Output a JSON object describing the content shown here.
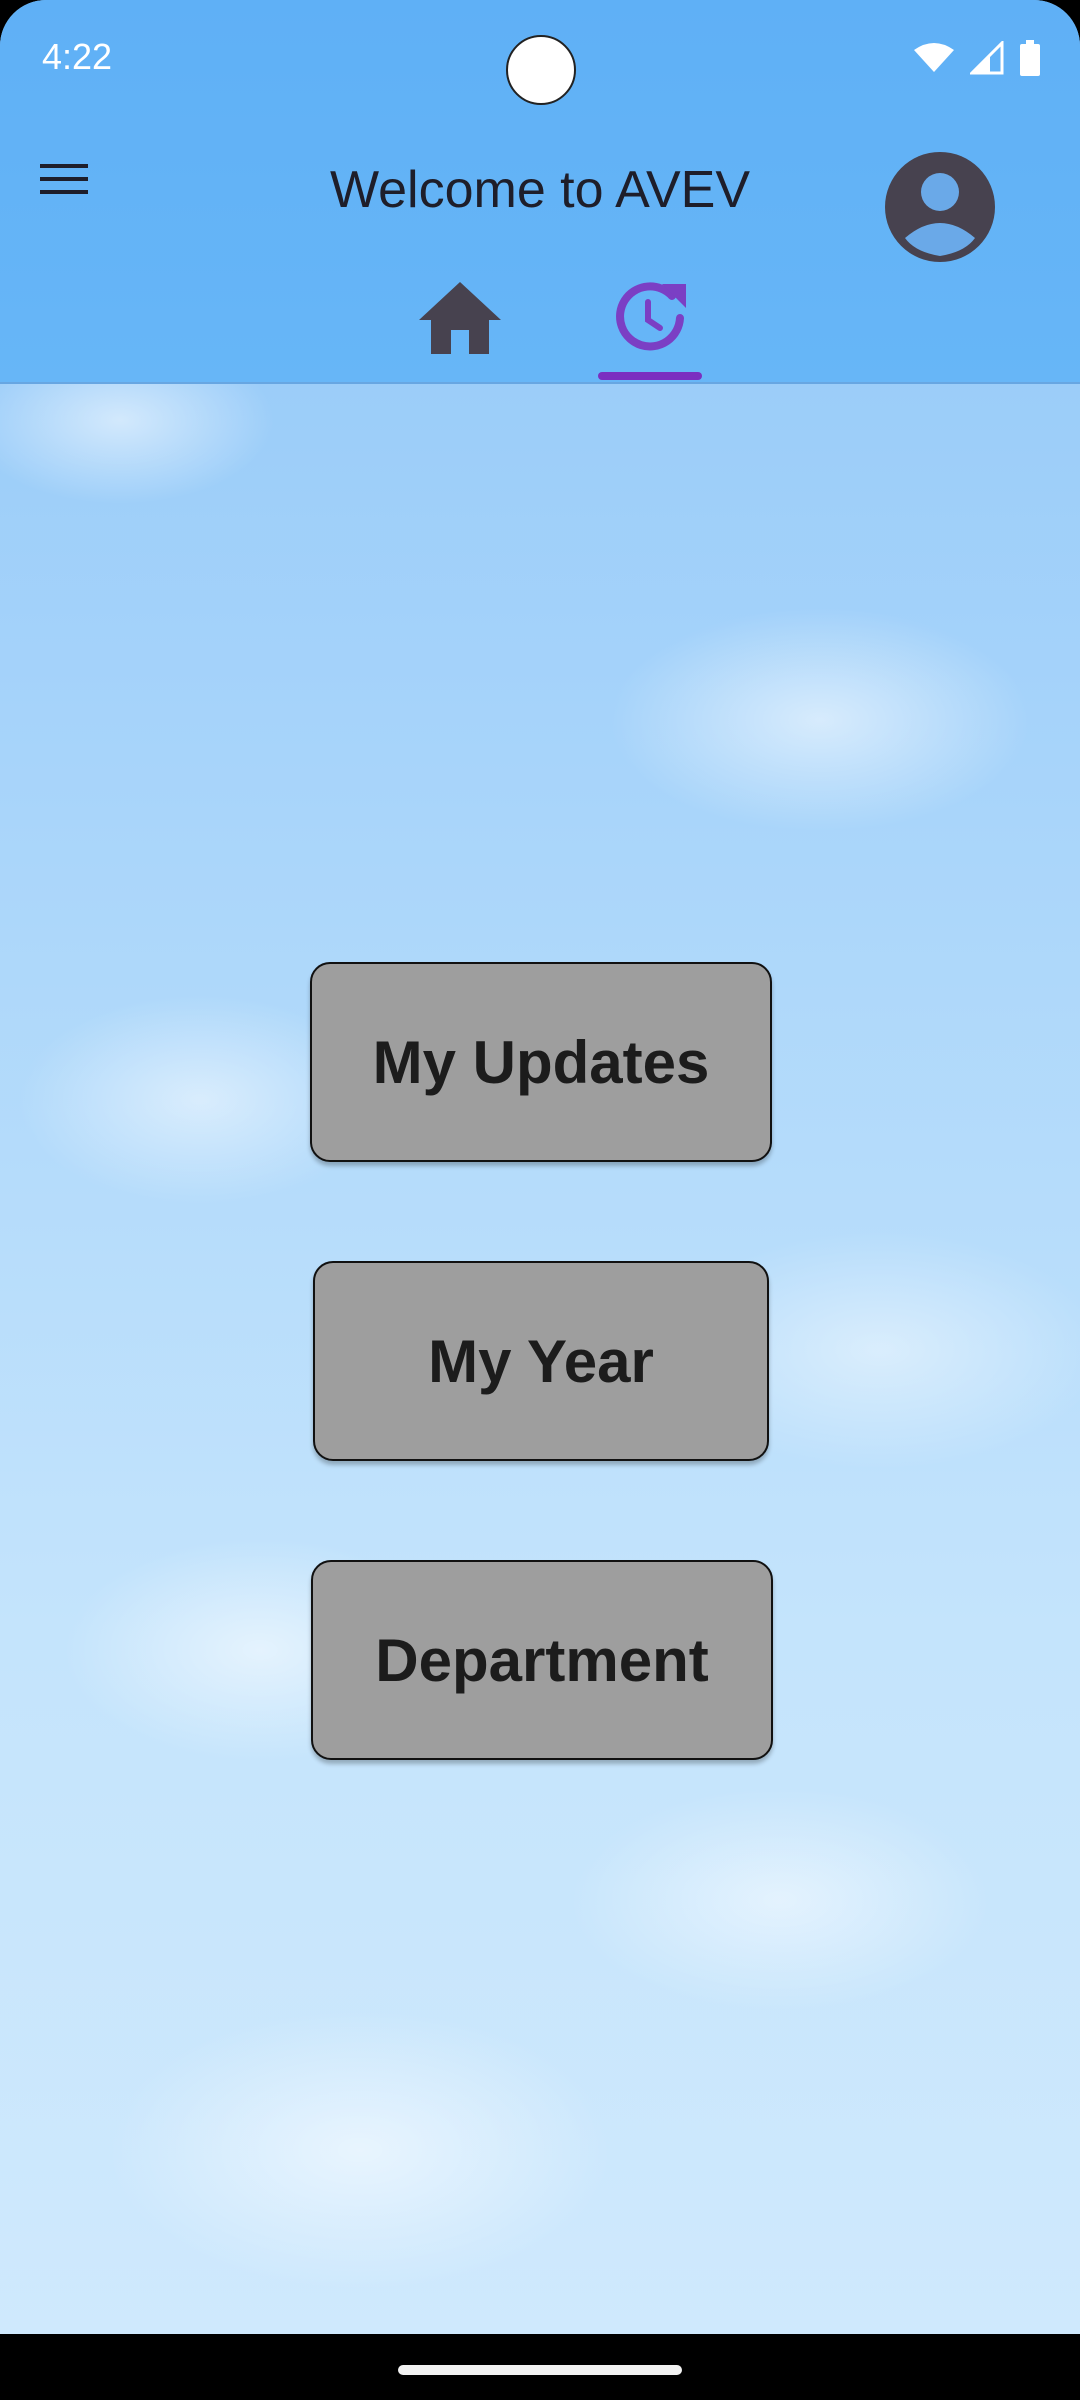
{
  "status_bar": {
    "time": "4:22",
    "icons": [
      "wifi-icon",
      "signal-icon",
      "battery-icon"
    ]
  },
  "app_bar": {
    "title": "Welcome to AVEV",
    "menu_icon": "hamburger-menu-icon",
    "profile_icon": "account-circle-icon"
  },
  "tabs": [
    {
      "icon": "home-icon",
      "selected": false
    },
    {
      "icon": "history-icon",
      "selected": true
    }
  ],
  "main": {
    "buttons": [
      "My Updates",
      "My Year",
      "Department"
    ]
  },
  "colors": {
    "app_bar": "#5fb0f6",
    "accent": "#7b2fc0",
    "button_bg": "#9e9e9e",
    "icon_dark": "#47424f"
  }
}
